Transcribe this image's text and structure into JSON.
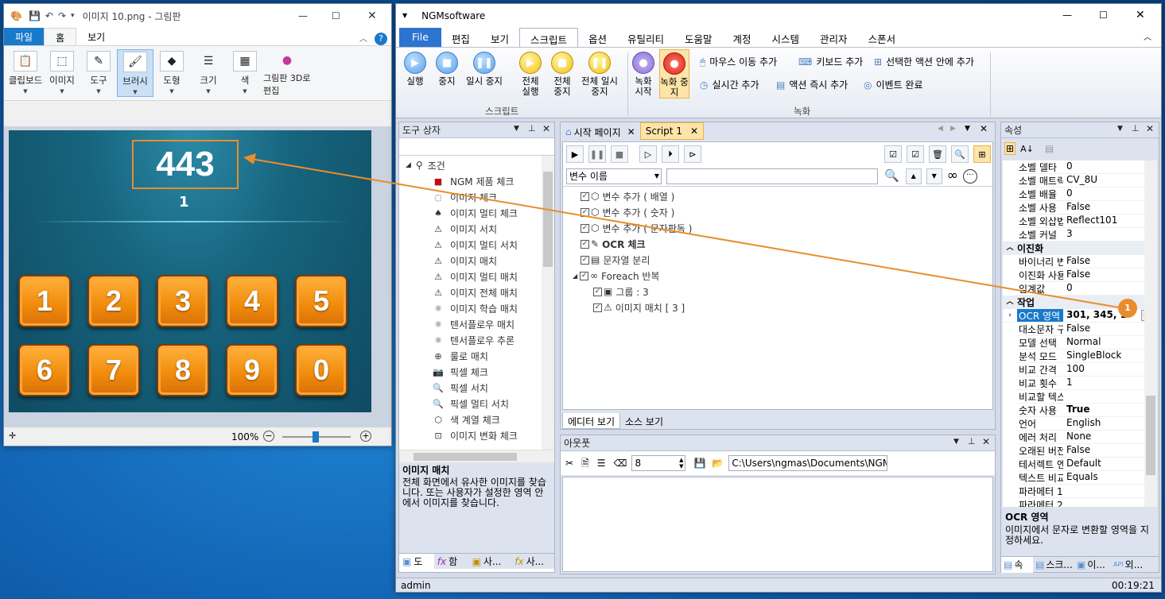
{
  "paint": {
    "title": "이미지 10.png - 그림판",
    "tabs": [
      "파일",
      "홈",
      "보기"
    ],
    "tools": [
      {
        "label": "클립보드",
        "icon": "clipboard-icon"
      },
      {
        "label": "이미지",
        "icon": "image-select-icon"
      },
      {
        "label": "도구",
        "icon": "tools-icon"
      },
      {
        "label": "브러시",
        "icon": "brush-icon"
      },
      {
        "label": "도형",
        "icon": "shapes-icon"
      },
      {
        "label": "크기",
        "icon": "size-icon"
      },
      {
        "label": "색",
        "icon": "color-icon"
      },
      {
        "label": "그림판 3D로 편집",
        "icon": "paint3d-icon"
      }
    ],
    "score": "443",
    "sub": "1",
    "keys": [
      "1",
      "2",
      "3",
      "4",
      "5",
      "6",
      "7",
      "8",
      "9",
      "0"
    ],
    "zoom": "100%"
  },
  "ngm": {
    "title": "NGMsoftware",
    "menu": [
      "File",
      "편집",
      "보기",
      "스크립트",
      "옵션",
      "유틸리티",
      "도움말",
      "계정",
      "시스템",
      "관리자",
      "스폰서"
    ],
    "ribbon": {
      "script": [
        {
          "label": "실행"
        },
        {
          "label": "중지"
        },
        {
          "label": "일시 중지"
        },
        {
          "label": "전체 실행"
        },
        {
          "label": "전체 중지"
        },
        {
          "label": "전체 일시 중지"
        }
      ],
      "script_group": "스크립트",
      "rec": [
        {
          "label": "녹화 시작"
        },
        {
          "label": "녹화 중지"
        }
      ],
      "actions": [
        "마우스 이동 추가",
        "키보드 추가",
        "선택한 액션 안에 추가",
        "실시간 추가",
        "액션 즉시 추가",
        "이벤트 완료"
      ],
      "rec_group": "녹화"
    },
    "toolbox": {
      "title": "도구 상자",
      "root": "조건",
      "items": [
        "NGM 제품 체크",
        "이미지 체크",
        "이미지 멀티 체크",
        "이미지 서치",
        "이미지 멀티 서치",
        "이미지 매치",
        "이미지 멀티 매치",
        "이미지 전체 매치",
        "이미지 학습 매치",
        "텐서플로우 매치",
        "텐서플로우 추론",
        "룰로 매치",
        "픽셀 체크",
        "픽셀 서치",
        "픽셀 멀티 서치",
        "색 계열 체크",
        "이미지 변화 체크"
      ],
      "desc_title": "이미지 매치",
      "desc": "전체 화면에서 유사한 이미지를 찾습니다. 또는 사용자가 설정한 영역 안에서 이미지를 찾습니다.",
      "tabs": [
        "도",
        "함",
        "사...",
        "사..."
      ]
    },
    "editor": {
      "tabs": [
        "시작 페이지",
        "Script 1"
      ],
      "var_combo": "변수 이름",
      "lines": [
        "변수 추가 ( 배열 )",
        "변수 추가 ( 숫자 )",
        "변수 추가 ( 문자판독 )",
        "OCR 체크",
        "문자열 분리",
        "Foreach 반복",
        "그룹 : 3",
        "이미지 매치 [ 3 ]"
      ],
      "bottom_tabs": [
        "에디터 보기",
        "소스 보기"
      ]
    },
    "output": {
      "title": "아웃풋",
      "num": "8",
      "path": "C:\\Users\\ngmas\\Documents\\NGM6\\"
    },
    "props": {
      "title": "속성",
      "rows": [
        {
          "k": "소벨 델타",
          "v": "0"
        },
        {
          "k": "소벨 매트릭",
          "v": "CV_8U"
        },
        {
          "k": "소벨 배율",
          "v": "0"
        },
        {
          "k": "소벨 사용",
          "v": "False"
        },
        {
          "k": "소벨 외삽법",
          "v": "Reflect101"
        },
        {
          "k": "소벨 커널",
          "v": "3"
        }
      ],
      "cat1": "이진화",
      "rows2": [
        {
          "k": "바이너리 변환",
          "v": "False"
        },
        {
          "k": "이진화 사용",
          "v": "False"
        },
        {
          "k": "임계값",
          "v": "0"
        }
      ],
      "cat2": "작업",
      "ocr": {
        "k": "OCR 영역",
        "v": "301, 345, 1"
      },
      "rows3": [
        {
          "k": "대소문자 구분",
          "v": "False"
        },
        {
          "k": "모델 선택",
          "v": "Normal"
        },
        {
          "k": "분석 모드",
          "v": "SingleBlock"
        },
        {
          "k": "비교 간격",
          "v": "100"
        },
        {
          "k": "비교 횟수",
          "v": "1"
        },
        {
          "k": "비교할 텍스트",
          "v": ""
        },
        {
          "k": "숫자 사용",
          "v": "True"
        },
        {
          "k": "언어",
          "v": "English"
        },
        {
          "k": "에러 처리",
          "v": "None"
        },
        {
          "k": "오래된 버전",
          "v": "False"
        },
        {
          "k": "테서렉트 엔진",
          "v": "Default"
        },
        {
          "k": "텍스트 비교",
          "v": "Equals"
        },
        {
          "k": "파라메터 1",
          "v": ""
        },
        {
          "k": "파라메터 2",
          "v": ""
        }
      ],
      "desc_title": "OCR 영역",
      "desc": "이미지에서 문자로 변환할 영역을 지정하세요.",
      "tabs": [
        "속",
        "스크...",
        "이...",
        "외..."
      ]
    },
    "status": {
      "user": "admin",
      "time": "00:19:21"
    }
  },
  "badge": "1"
}
